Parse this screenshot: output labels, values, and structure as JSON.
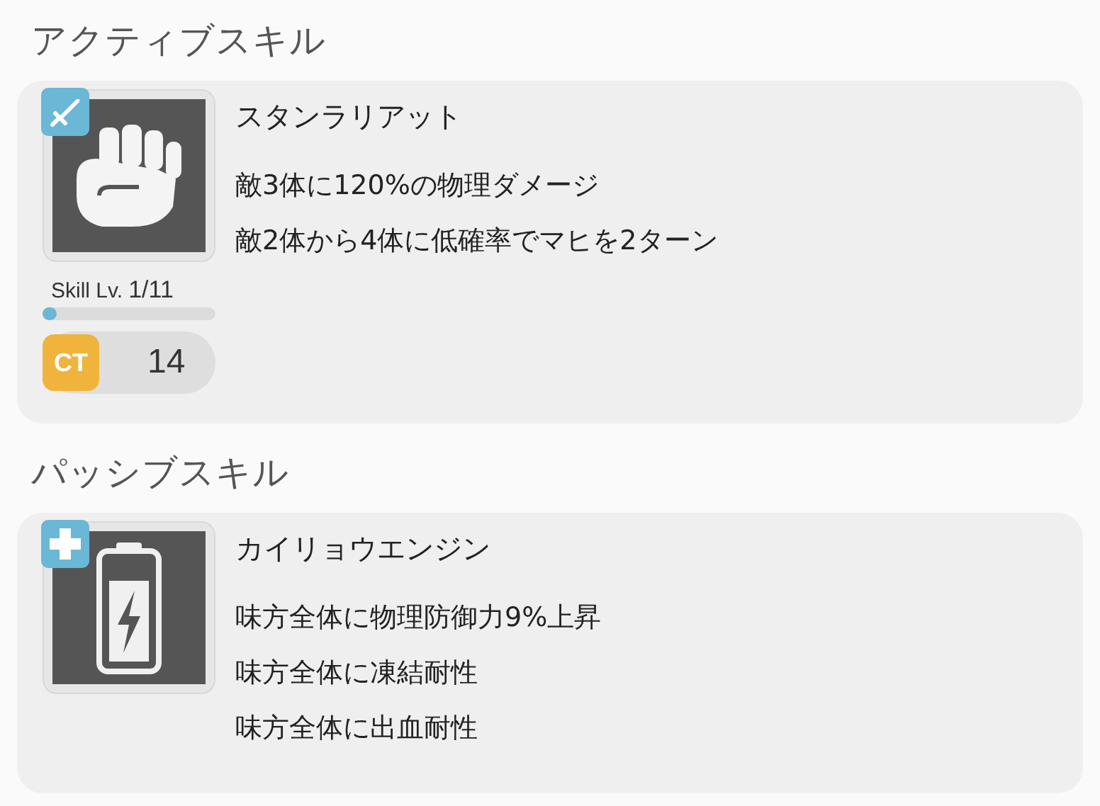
{
  "sections": [
    {
      "kind": "active",
      "title": "アクティブスキル",
      "skill": {
        "name": "スタンラリアット",
        "descriptions": [
          "敵3体に120%の物理ダメージ",
          "敵2体から4体に低確率でマヒを2ターン"
        ],
        "level_label": "Skill Lv.",
        "level_value": "1/11",
        "level": 0.08,
        "ct_label": "CT",
        "ct": "14"
      }
    },
    {
      "kind": "passive",
      "title": "パッシブスキル",
      "skill": {
        "name": "カイリョウエンジン",
        "descriptions": [
          "味方全体に物理防御力9%上昇",
          "味方全体に凍結耐性",
          "味方全体に出血耐性"
        ]
      }
    }
  ]
}
